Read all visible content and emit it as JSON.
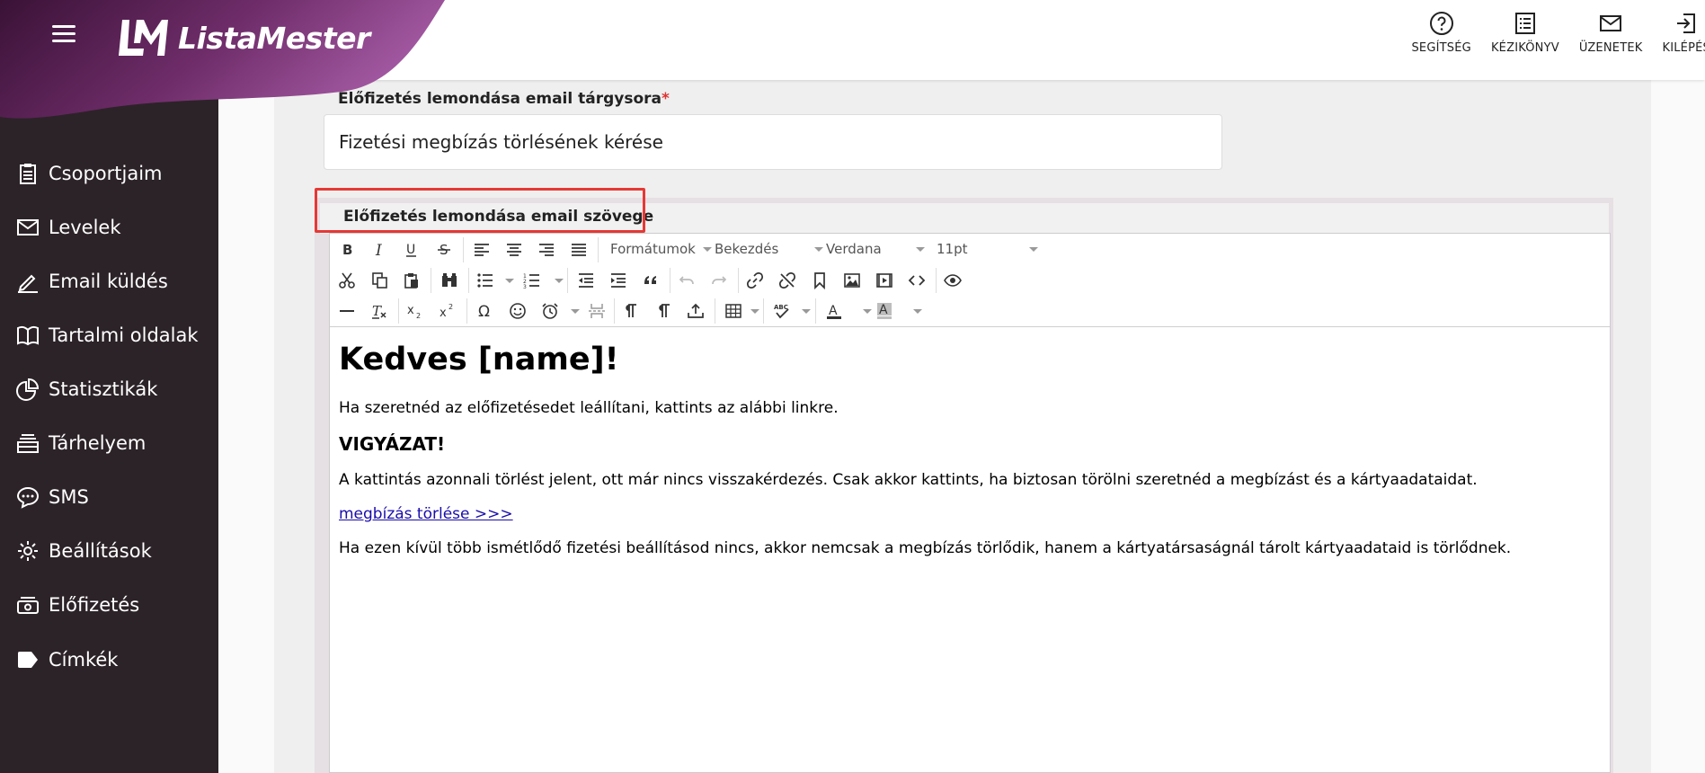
{
  "header": {
    "brand": "ListaMester",
    "colors": {
      "brand_dark": "#3a1236",
      "brand_light": "#a45aa3",
      "sidebar_bg": "#2c2328",
      "highlight": "#e53935"
    },
    "actions": [
      {
        "label": "SEGÍTSÉG",
        "icon": "help-circle-icon"
      },
      {
        "label": "KÉZIKÖNYV",
        "icon": "manual-icon"
      },
      {
        "label": "ÜZENETEK",
        "icon": "mail-icon"
      },
      {
        "label": "KILÉPÉS",
        "icon": "logout-icon"
      }
    ]
  },
  "sidebar": {
    "items": [
      {
        "label": "Csoportjaim",
        "icon": "clipboard-icon"
      },
      {
        "label": "Levelek",
        "icon": "envelope-icon"
      },
      {
        "label": "Email küldés",
        "icon": "pencil-icon"
      },
      {
        "label": "Tartalmi oldalak",
        "icon": "book-icon"
      },
      {
        "label": "Statisztikák",
        "icon": "pie-chart-icon"
      },
      {
        "label": "Tárhelyem",
        "icon": "storage-icon"
      },
      {
        "label": "SMS",
        "icon": "chat-bubble-icon"
      },
      {
        "label": "Beállítások",
        "icon": "gear-icon"
      },
      {
        "label": "Előfizetés",
        "icon": "money-icon"
      },
      {
        "label": "Címkék",
        "icon": "tag-icon"
      }
    ]
  },
  "form": {
    "subject_label": "Előfizetés lemondása email tárgysora",
    "required_mark": "*",
    "subject_value": "Fizetési megbízás törlésének kérése",
    "body_label": "Előfizetés lemondása email szövege"
  },
  "toolbar": {
    "format_label": "Formátumok",
    "block_label": "Bekezdés",
    "font_label": "Verdana",
    "size_label": "11pt"
  },
  "email_body": {
    "heading": "Kedves [name]!",
    "intro": "Ha szeretnéd az előfizetésedet leállítani, kattints az alábbi linkre.",
    "warning_title": "VIGYÁZAT!",
    "warning_text": "A kattintás azonnali törlést jelent, ott már nincs visszakérdezés. Csak akkor kattints, ha biztosan törölni szeretnéd a megbízást és a kártyaadataidat.",
    "link_text": "megbízás törlése >>>",
    "footer_text": "Ha ezen kívül több ismétlődő fizetési beállításod nincs, akkor nemcsak a megbízás törlődik, hanem a kártyatársaságnál tárolt kártyaadataid is törlődnek."
  }
}
